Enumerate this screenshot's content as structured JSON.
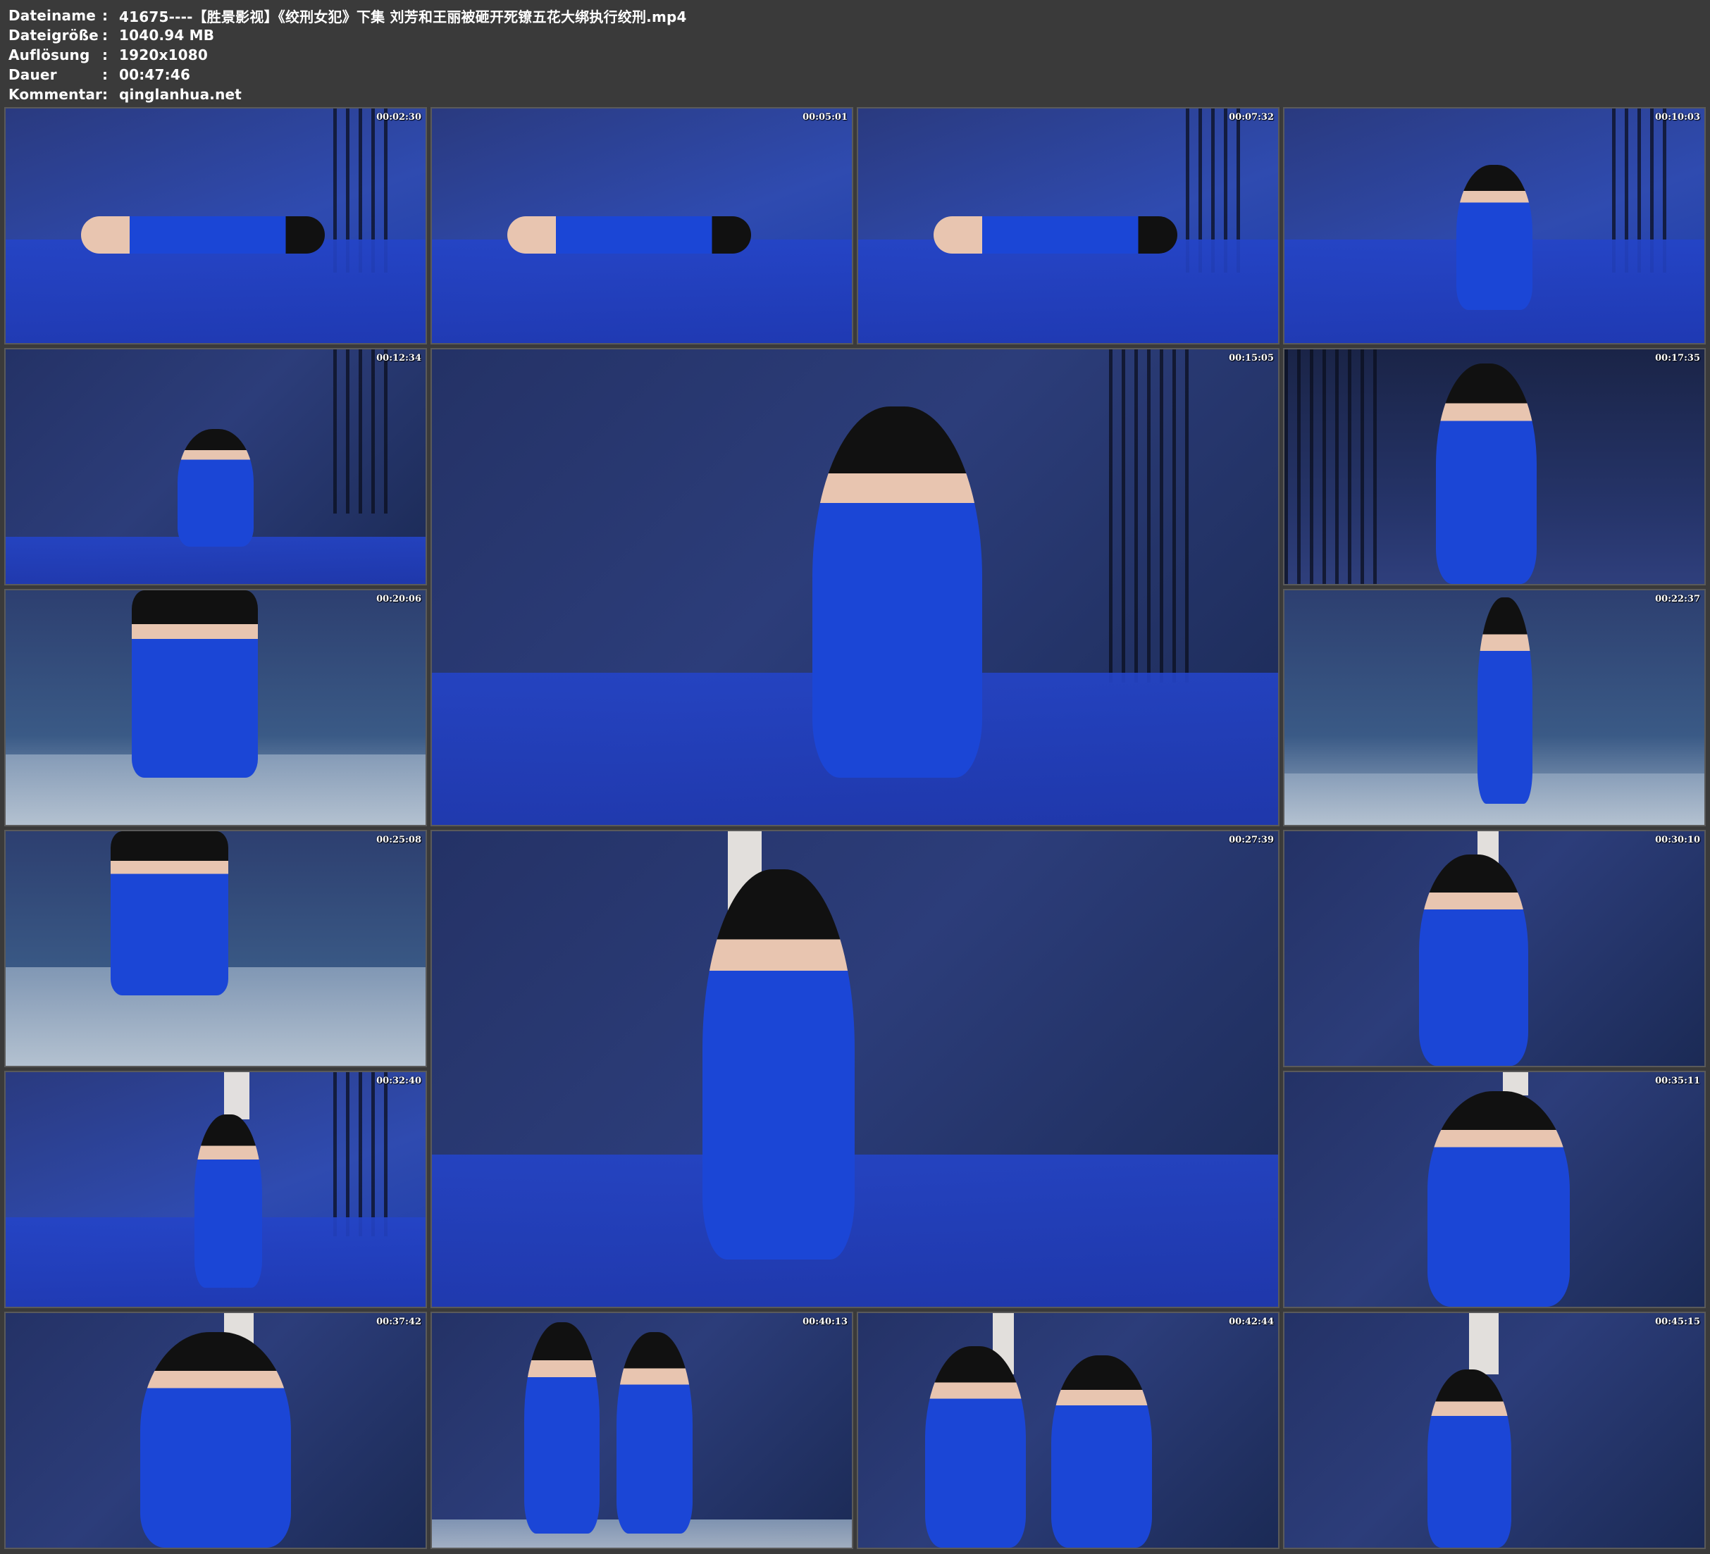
{
  "header": {
    "rows": [
      {
        "label": "Dateiname",
        "separator": ":",
        "value": "41675----【胜景影视】《绞刑女犯》下集 刘芳和王丽被砸开死镣五花大绑执行绞刑.mp4"
      },
      {
        "label": "Dateigröße",
        "separator": ":",
        "value": "1040.94 MB"
      },
      {
        "label": "Auflösung",
        "separator": ":",
        "value": "1920x1080"
      },
      {
        "label": "Dauer",
        "separator": ":",
        "value": "00:47:46"
      },
      {
        "label": "Kommentar",
        "separator": ":",
        "value": "qinglanhua.net"
      }
    ]
  },
  "thumbnails": [
    {
      "timestamp": "00:02:30"
    },
    {
      "timestamp": "00:05:01"
    },
    {
      "timestamp": "00:07:32"
    },
    {
      "timestamp": "00:10:03"
    },
    {
      "timestamp": "00:12:34"
    },
    {
      "timestamp": "00:15:05"
    },
    {
      "timestamp": "00:17:35"
    },
    {
      "timestamp": "00:20:06"
    },
    {
      "timestamp": "00:22:37"
    },
    {
      "timestamp": "00:25:08"
    },
    {
      "timestamp": "00:27:39"
    },
    {
      "timestamp": "00:30:10"
    },
    {
      "timestamp": "00:32:40"
    },
    {
      "timestamp": "00:35:11"
    },
    {
      "timestamp": "00:37:42"
    },
    {
      "timestamp": "00:40:13"
    },
    {
      "timestamp": "00:42:44"
    },
    {
      "timestamp": "00:45:15"
    }
  ]
}
